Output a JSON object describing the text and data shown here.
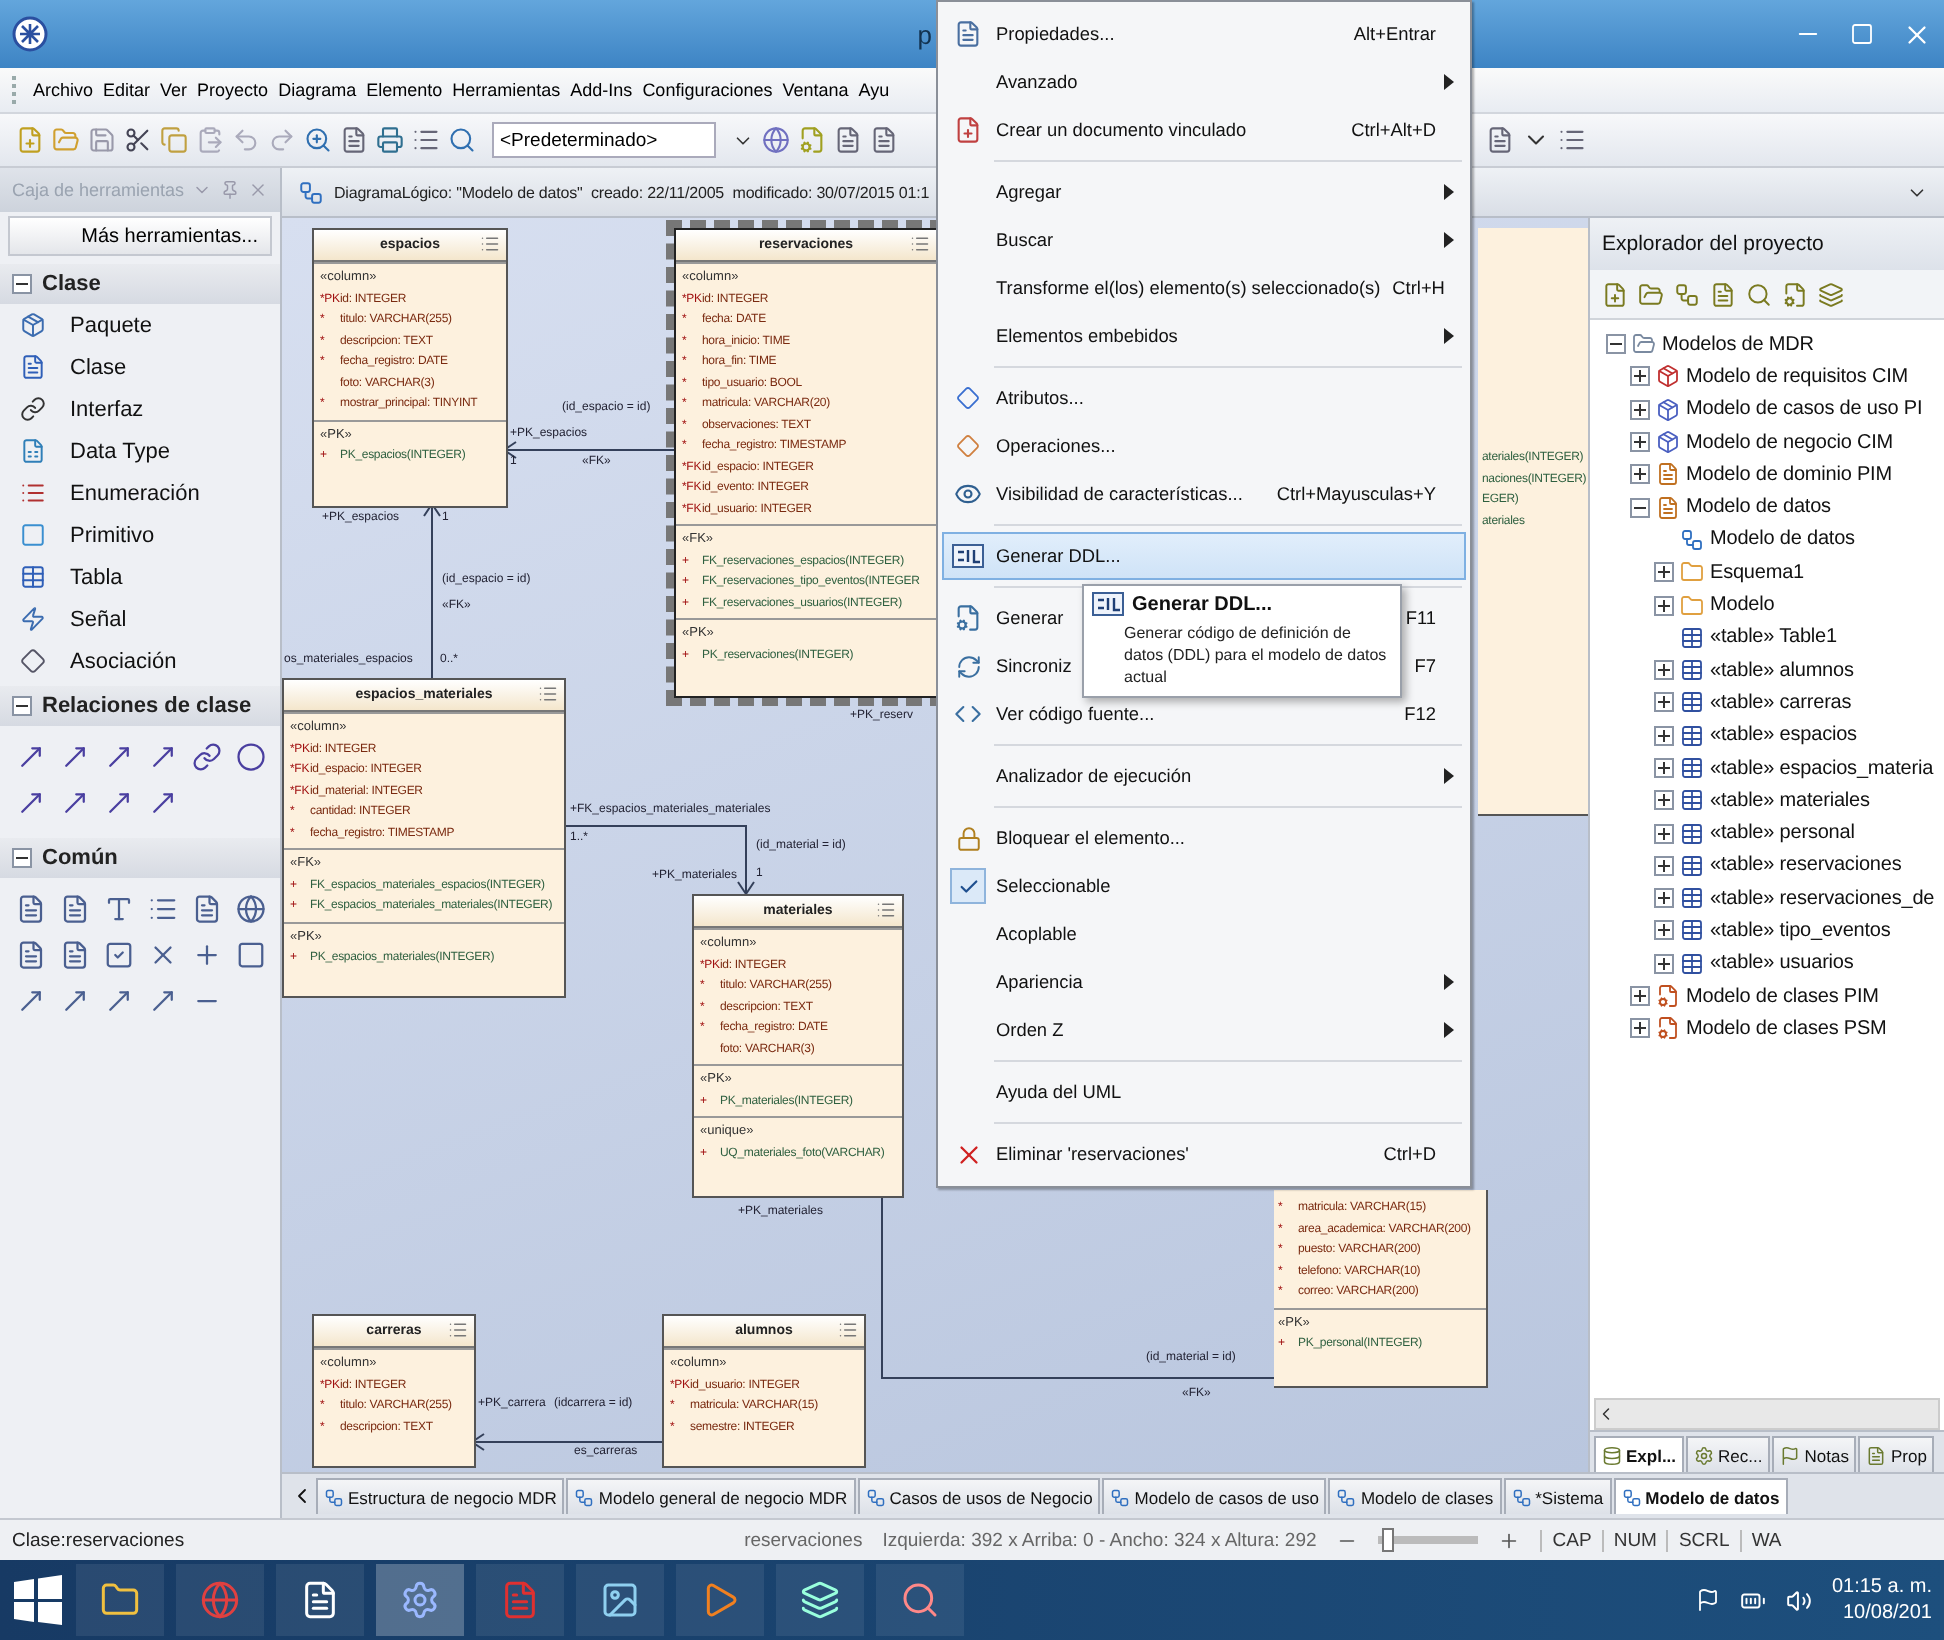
{
  "window": {
    "title": "p"
  },
  "menu_bar": [
    "Archivo",
    "Editar",
    "Ver",
    "Proyecto",
    "Diagrama",
    "Elemento",
    "Herramientas",
    "Add-Ins",
    "Configuraciones",
    "Ventana",
    "Ayu"
  ],
  "toolbar": {
    "style_dropdown": "<Predeterminado>"
  },
  "toolbox": {
    "title": "Caja de herramientas",
    "more_button": "Más herramientas...",
    "sections": [
      {
        "title": "Clase",
        "kind": "list",
        "expanded": true,
        "items": [
          {
            "label": "Paquete",
            "kind": "package"
          },
          {
            "label": "Clase",
            "kind": "class"
          },
          {
            "label": "Interfaz",
            "kind": "interface"
          },
          {
            "label": "Data Type",
            "kind": "datatype"
          },
          {
            "label": "Enumeración",
            "kind": "enumeration"
          },
          {
            "label": "Primitivo",
            "kind": "primitive"
          },
          {
            "label": "Tabla",
            "kind": "table"
          },
          {
            "label": "Señal",
            "kind": "signal"
          },
          {
            "label": "Asociación",
            "kind": "association"
          }
        ]
      },
      {
        "title": "Relaciones de clase",
        "kind": "relations",
        "expanded": true
      },
      {
        "title": "Común",
        "kind": "common",
        "expanded": true
      }
    ]
  },
  "diagram": {
    "header": "DiagramaLógico: \"Modelo de datos\"  creado: 22/11/2005  modificado: 30/07/2015 01:1",
    "tables": [
      {
        "kind": "table",
        "name": "espacios",
        "selected": false,
        "sections": [
          {
            "stereotype": "«column»",
            "kind": "columns",
            "rows": [
              {
                "mark": "*PK",
                "text": "id: INTEGER"
              },
              {
                "mark": "*",
                "text": "titulo: VARCHAR(255)"
              },
              {
                "mark": "*",
                "text": "descripcion: TEXT"
              },
              {
                "mark": "*",
                "text": "fecha_registro: DATE"
              },
              {
                "text": "foto: VARCHAR(3)"
              },
              {
                "mark": "*",
                "text": "mostrar_principal: TINYINT"
              }
            ]
          },
          {
            "stereotype": "«PK»",
            "kind": "keys",
            "rows": [
              {
                "mark": "+",
                "text": "PK_espacios(INTEGER)"
              }
            ]
          }
        ]
      },
      {
        "kind": "table",
        "name": "reservaciones",
        "selected": true,
        "sections": [
          {
            "stereotype": "«column»",
            "kind": "columns",
            "rows": [
              {
                "mark": "*PK",
                "text": "id: INTEGER"
              },
              {
                "mark": "*",
                "text": "fecha: DATE"
              },
              {
                "mark": "*",
                "text": "hora_inicio: TIME"
              },
              {
                "mark": "*",
                "text": "hora_fin: TIME"
              },
              {
                "mark": "*",
                "text": "tipo_usuario: BOOL"
              },
              {
                "mark": "*",
                "text": "matricula: VARCHAR(20)"
              },
              {
                "mark": "*",
                "text": "observaciones: TEXT"
              },
              {
                "mark": "*",
                "text": "fecha_registro: TIMESTAMP"
              },
              {
                "mark": "*FK",
                "text": "id_espacio: INTEGER"
              },
              {
                "mark": "*FK",
                "text": "id_evento: INTEGER"
              },
              {
                "mark": "*FK",
                "text": "id_usuario: INTEGER"
              }
            ]
          },
          {
            "stereotype": "«FK»",
            "kind": "keys",
            "rows": [
              {
                "mark": "+",
                "text": "FK_reservaciones_espacios(INTEGER)"
              },
              {
                "mark": "+",
                "text": "FK_reservaciones_tipo_eventos(INTEGER"
              },
              {
                "mark": "+",
                "text": "FK_reservaciones_usuarios(INTEGER)"
              }
            ]
          },
          {
            "stereotype": "«PK»",
            "kind": "keys",
            "rows": [
              {
                "mark": "+",
                "text": "PK_reservaciones(INTEGER)"
              }
            ]
          }
        ]
      },
      {
        "kind": "partial",
        "selected": false,
        "sections": [
          {
            "kind": "keys",
            "rows": [
              {
                "text": "ateriales(INTEGER)"
              },
              {
                "text": "naciones(INTEGER)"
              },
              {
                "text": "EGER)"
              },
              {
                "text": "ateriales"
              }
            ]
          }
        ]
      },
      {
        "kind": "table",
        "name": "espacios_materiales",
        "selected": false,
        "sections": [
          {
            "stereotype": "«column»",
            "kind": "columns",
            "rows": [
              {
                "mark": "*PK",
                "text": "id: INTEGER"
              },
              {
                "mark": "*FK",
                "text": "id_espacio: INTEGER"
              },
              {
                "mark": "*FK",
                "text": "id_material: INTEGER"
              },
              {
                "mark": "*",
                "text": "cantidad: INTEGER"
              },
              {
                "mark": "*",
                "text": "fecha_registro: TIMESTAMP"
              }
            ]
          },
          {
            "stereotype": "«FK»",
            "kind": "keys",
            "rows": [
              {
                "mark": "+",
                "text": "FK_espacios_materiales_espacios(INTEGER)"
              },
              {
                "mark": "+",
                "text": "FK_espacios_materiales_materiales(INTEGER)"
              }
            ]
          },
          {
            "stereotype": "«PK»",
            "kind": "keys",
            "rows": [
              {
                "mark": "+",
                "text": "PK_espacios_materiales(INTEGER)"
              }
            ]
          }
        ]
      },
      {
        "kind": "table",
        "name": "materiales",
        "selected": false,
        "sections": [
          {
            "stereotype": "«column»",
            "kind": "columns",
            "rows": [
              {
                "mark": "*PK",
                "text": "id: INTEGER"
              },
              {
                "mark": "*",
                "text": "titulo: VARCHAR(255)"
              },
              {
                "mark": "*",
                "text": "descripcion: TEXT"
              },
              {
                "mark": "*",
                "text": "fecha_registro: DATE"
              },
              {
                "text": "foto: VARCHAR(3)"
              }
            ]
          },
          {
            "stereotype": "«PK»",
            "kind": "keys",
            "rows": [
              {
                "mark": "+",
                "text": "PK_materiales(INTEGER)"
              }
            ]
          },
          {
            "stereotype": "«unique»",
            "kind": "keys",
            "rows": [
              {
                "mark": "+",
                "text": "UQ_materiales_foto(VARCHAR)"
              }
            ]
          }
        ]
      },
      {
        "kind": "partial",
        "selected": false,
        "sections": [
          {
            "kind": "columns",
            "rows": [
              {
                "mark": "*",
                "text": "matricula: VARCHAR(15)"
              },
              {
                "mark": "*",
                "text": "area_academica: VARCHAR(200)"
              },
              {
                "mark": "*",
                "text": "puesto: VARCHAR(200)"
              },
              {
                "mark": "*",
                "text": "telefono: VARCHAR(10)"
              },
              {
                "mark": "*",
                "text": "correo: VARCHAR(200)"
              }
            ]
          },
          {
            "stereotype": "«PK»",
            "kind": "keys",
            "rows": [
              {
                "mark": "+",
                "text": "PK_personal(INTEGER)"
              }
            ]
          }
        ]
      },
      {
        "kind": "table",
        "name": "carreras",
        "selected": false,
        "sections": [
          {
            "stereotype": "«column»",
            "kind": "columns",
            "rows": [
              {
                "mark": "*PK",
                "text": "id: INTEGER"
              },
              {
                "mark": "*",
                "text": "titulo: VARCHAR(255)"
              },
              {
                "mark": "*",
                "text": "descripcion: TEXT"
              }
            ]
          }
        ]
      },
      {
        "kind": "table",
        "name": "alumnos",
        "selected": false,
        "sections": [
          {
            "stereotype": "«column»",
            "kind": "columns",
            "rows": [
              {
                "mark": "*PK",
                "text": "id_usuario: INTEGER"
              },
              {
                "mark": "*",
                "text": "matricula: VARCHAR(15)"
              },
              {
                "mark": "*",
                "text": "semestre: INTEGER"
              }
            ]
          }
        ]
      }
    ],
    "labels": [
      "+PK_espacios",
      "(id_espacio = id)",
      "«FK»",
      "1",
      "+PK_espacios",
      "1",
      "(id_espacio = id)",
      "«FK»",
      "os_materiales_espacios",
      "0..*",
      "+FK_espacios_materiales_materiales",
      "1..*",
      "(id_material = id)",
      "+PK_materiales",
      "1",
      "+PK_reserv",
      "+PK_materiales",
      "(id_material = id)",
      "«FK»",
      "+PK_carrera",
      "(idcarrera = id)",
      "es_carreras"
    ]
  },
  "context_menu": {
    "items": [
      {
        "kind": "item",
        "label": "Propiedades...",
        "shortcut": "Alt+Entrar",
        "submenu": false,
        "selected": false,
        "checked": false
      },
      {
        "kind": "item",
        "label": "Avanzado",
        "submenu": true,
        "selected": false,
        "checked": false
      },
      {
        "kind": "item",
        "label": "Crear un documento vinculado",
        "shortcut": "Ctrl+Alt+D",
        "submenu": false,
        "selected": false,
        "checked": false
      },
      {
        "kind": "separator"
      },
      {
        "kind": "item",
        "label": "Agregar",
        "submenu": true,
        "selected": false,
        "checked": false
      },
      {
        "kind": "item",
        "label": "Buscar",
        "submenu": true,
        "selected": false,
        "checked": false
      },
      {
        "kind": "item",
        "label": "Transforme el(los) elemento(s) seleccionado(s)",
        "shortcut": "Ctrl+H",
        "submenu": false,
        "selected": false,
        "checked": false
      },
      {
        "kind": "item",
        "label": "Elementos embebidos",
        "submenu": true,
        "selected": false,
        "checked": false
      },
      {
        "kind": "separator"
      },
      {
        "kind": "item",
        "label": "Atributos...",
        "submenu": false,
        "selected": false,
        "checked": false
      },
      {
        "kind": "item",
        "label": "Operaciones...",
        "submenu": false,
        "selected": false,
        "checked": false
      },
      {
        "kind": "item",
        "label": "Visibilidad de características...",
        "shortcut": "Ctrl+Mayusculas+Y",
        "submenu": false,
        "selected": false,
        "checked": false
      },
      {
        "kind": "separator"
      },
      {
        "kind": "item",
        "label": "Generar DDL...",
        "submenu": false,
        "selected": true,
        "checked": false
      },
      {
        "kind": "separator"
      },
      {
        "kind": "item",
        "label": "Generar",
        "shortcut": "F11",
        "submenu": false,
        "selected": false,
        "checked": false
      },
      {
        "kind": "item",
        "label": "Sincroniz",
        "shortcut": "F7",
        "submenu": false,
        "selected": false,
        "checked": false
      },
      {
        "kind": "item",
        "label": "Ver código fuente...",
        "shortcut": "F12",
        "submenu": false,
        "selected": false,
        "checked": false
      },
      {
        "kind": "separator"
      },
      {
        "kind": "item",
        "label": "Analizador de ejecución",
        "submenu": true,
        "selected": false,
        "checked": false
      },
      {
        "kind": "separator"
      },
      {
        "kind": "item",
        "label": "Bloquear el elemento...",
        "submenu": false,
        "selected": false,
        "checked": false
      },
      {
        "kind": "item",
        "label": "Seleccionable",
        "submenu": false,
        "selected": false,
        "checked": true
      },
      {
        "kind": "item",
        "label": "Acoplable",
        "submenu": false,
        "selected": false,
        "checked": false
      },
      {
        "kind": "item",
        "label": "Apariencia",
        "submenu": true,
        "selected": false,
        "checked": false
      },
      {
        "kind": "item",
        "label": "Orden Z",
        "submenu": true,
        "selected": false,
        "checked": false
      },
      {
        "kind": "separator"
      },
      {
        "kind": "item",
        "label": "Ayuda del UML",
        "submenu": false,
        "selected": false,
        "checked": false
      },
      {
        "kind": "separator"
      },
      {
        "kind": "item",
        "label": "Eliminar 'reservaciones'",
        "shortcut": "Ctrl+D",
        "submenu": false,
        "selected": false,
        "checked": false
      }
    ],
    "tooltip": {
      "title": "Generar DDL...",
      "text": "Generar código de definición de datos (DDL) para el modelo de datos actual"
    }
  },
  "explorer": {
    "title": "Explorador del proyecto",
    "tree": [
      {
        "label": "Modelos de MDR",
        "kind": "root",
        "expanded": true,
        "children": [
          {
            "label": "Modelo de requisitos CIM",
            "kind": "package-red",
            "expanded": false
          },
          {
            "label": "Modelo de casos de uso PI",
            "kind": "package-blue",
            "expanded": false
          },
          {
            "label": "Modelo de negocio CIM",
            "kind": "package-blue",
            "expanded": false
          },
          {
            "label": "Modelo de dominio PIM",
            "kind": "package-doc",
            "expanded": false
          },
          {
            "label": "Modelo de datos",
            "kind": "package-doc",
            "expanded": true,
            "children": [
              {
                "label": "Modelo de datos",
                "kind": "diagram"
              },
              {
                "label": "Esquema1",
                "kind": "folder",
                "expanded": false
              },
              {
                "label": "Modelo",
                "kind": "folder",
                "expanded": false
              },
              {
                "label": "«table» Table1",
                "kind": "table"
              },
              {
                "label": "«table» alumnos",
                "kind": "table",
                "expanded": false
              },
              {
                "label": "«table» carreras",
                "kind": "table",
                "expanded": false
              },
              {
                "label": "«table» espacios",
                "kind": "table",
                "expanded": false
              },
              {
                "label": "«table» espacios_materia",
                "kind": "table",
                "expanded": false
              },
              {
                "label": "«table» materiales",
                "kind": "table",
                "expanded": false
              },
              {
                "label": "«table» personal",
                "kind": "table",
                "expanded": false
              },
              {
                "label": "«table» reservaciones",
                "kind": "table",
                "expanded": false
              },
              {
                "label": "«table» reservaciones_de",
                "kind": "table",
                "expanded": false
              },
              {
                "label": "«table» tipo_eventos",
                "kind": "table",
                "expanded": false
              },
              {
                "label": "«table» usuarios",
                "kind": "table",
                "expanded": false
              }
            ]
          },
          {
            "label": "Modelo de clases PIM",
            "kind": "package-class",
            "expanded": false
          },
          {
            "label": "Modelo de clases PSM",
            "kind": "package-class",
            "expanded": false
          }
        ]
      }
    ],
    "tabs": [
      {
        "label": "Expl...",
        "selected": true
      },
      {
        "label": "Rec...",
        "selected": false
      },
      {
        "label": "Notas",
        "selected": false
      },
      {
        "label": "Prop",
        "selected": false
      }
    ]
  },
  "diagram_tabs": [
    {
      "label": "Estructura de negocio MDR",
      "selected": false
    },
    {
      "label": "Modelo general de negocio MDR",
      "selected": false
    },
    {
      "label": "Casos de usos de Negocio",
      "selected": false
    },
    {
      "label": "Modelo de casos de uso",
      "selected": false
    },
    {
      "label": "Modelo de clases",
      "selected": false
    },
    {
      "label": "*Sistema",
      "selected": false
    },
    {
      "label": "Modelo de datos",
      "selected": true
    }
  ],
  "status_bar": {
    "element": "Clase:reservaciones",
    "name": "reservaciones",
    "geometry": "Izquierda: 392 x Arriba: 0 - Ancho: 324 x Altura: 292",
    "zoom": {
      "level": 0.1
    },
    "indicators": [
      "CAP",
      "NUM",
      "SCRL",
      "WA"
    ]
  },
  "taskbar": {
    "time": "01:15 a. m.",
    "date": "10/08/201"
  }
}
